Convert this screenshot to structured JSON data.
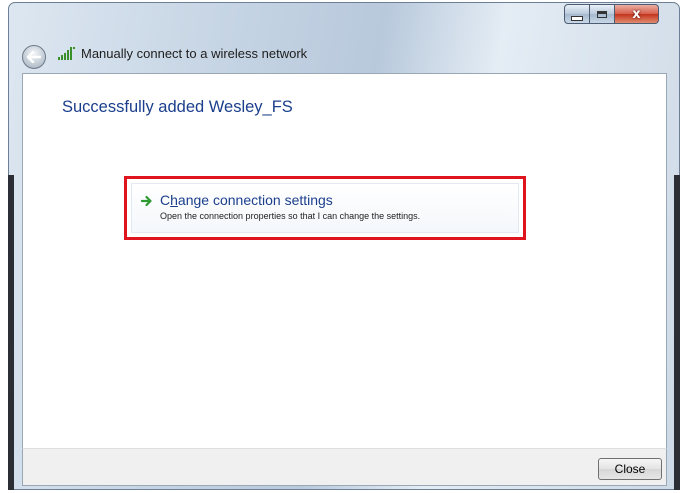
{
  "window": {
    "title": "Manually connect to a wireless network",
    "controls": {
      "minimize_icon": "minimize-icon",
      "maximize_icon": "maximize-icon",
      "close_glyph": "x"
    }
  },
  "content": {
    "heading": "Successfully added Wesley_FS",
    "task": {
      "icon": "green-arrow-icon",
      "title_prefix": "C",
      "title_accel": "h",
      "title_suffix": "ange connection settings",
      "description": "Open the connection properties so that I can change the settings."
    }
  },
  "footer": {
    "close_label": "Close"
  },
  "colors": {
    "link_blue": "#1b3f8c",
    "highlight_red": "#e0141c",
    "arrow_green": "#2e9a32"
  }
}
